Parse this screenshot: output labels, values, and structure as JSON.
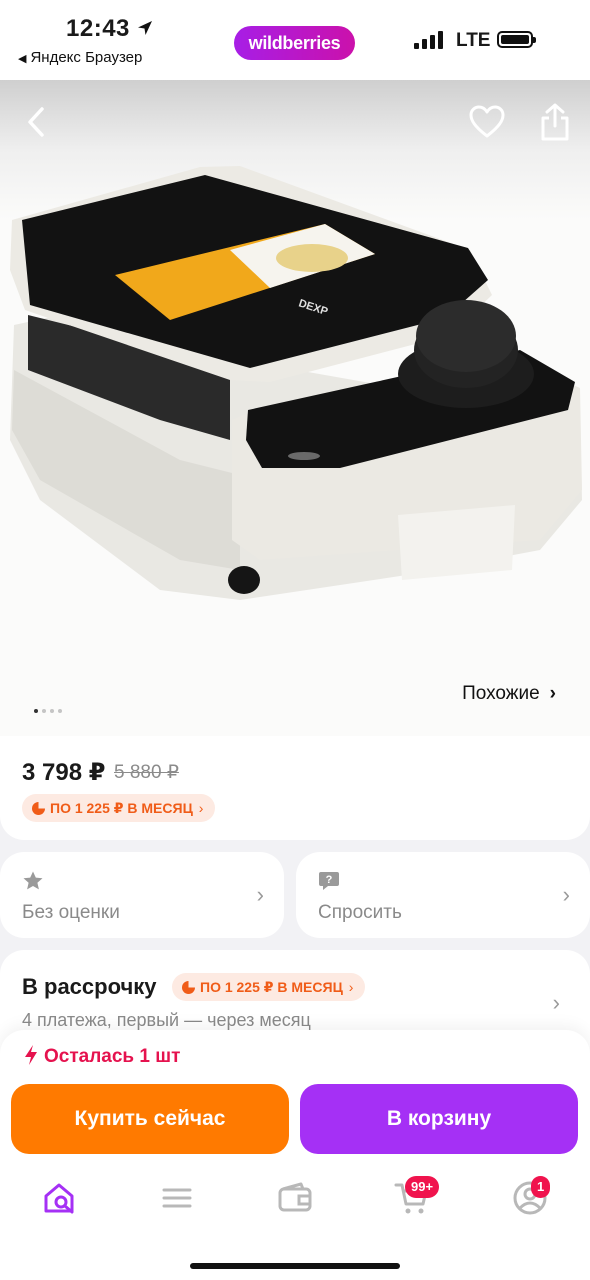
{
  "status_bar": {
    "time": "12:43",
    "back_app": "Яндекс Браузер",
    "brand": "wildberries",
    "network": "LTE"
  },
  "gallery": {
    "similar_label": "Похожие",
    "slide_count": 4,
    "active_slide": 1,
    "product_brand_print": "DEXP"
  },
  "price": {
    "current": "3 798 ₽",
    "old": "5 880 ₽",
    "installment_badge": "ПО 1 225 ₽ В МЕСЯЦ"
  },
  "tiles": {
    "rating_label": "Без оценки",
    "ask_label": "Спросить"
  },
  "installment": {
    "title": "В рассрочку",
    "badge": "ПО 1 225 ₽ В МЕСЯЦ",
    "subtitle": "4 платежа, первый — через месяц"
  },
  "bottom": {
    "stock": "Осталась 1 шт",
    "buy_now": "Купить сейчас",
    "add_to_cart": "В корзину"
  },
  "tabbar": {
    "cart_badge": "99+",
    "profile_badge": "1",
    "active_color": "#a530f5"
  },
  "colors": {
    "orange": "#ff7a00",
    "purple": "#a530f5",
    "alert": "#e5124e"
  }
}
